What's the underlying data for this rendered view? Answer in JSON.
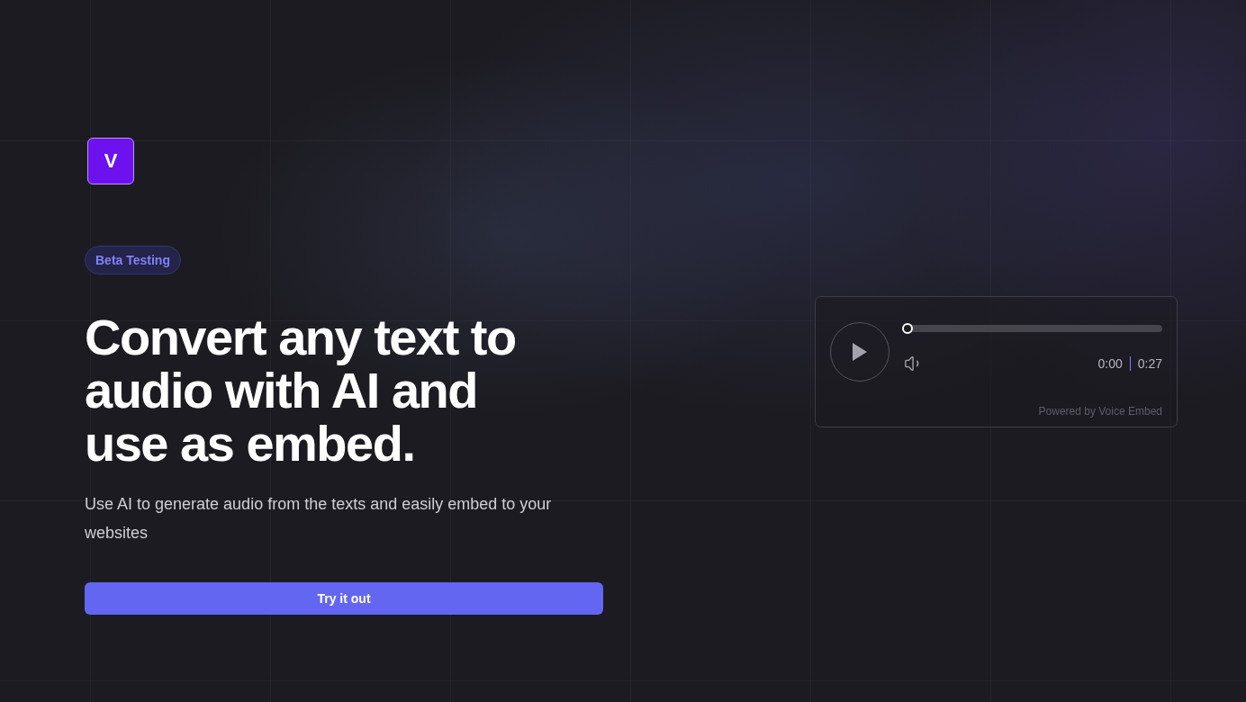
{
  "logo": {
    "letter": "V"
  },
  "badge": "Beta Testing",
  "headline": "Convert any text to audio with AI and use as embed.",
  "subtitle": "Use AI to generate audio from the texts and easily embed to your websites",
  "cta": "Try it out",
  "player": {
    "playing": false,
    "progress": {
      "level": 0
    },
    "current_time": "0:00",
    "duration": "0:27",
    "credit": "Powered by Voice Embed"
  }
}
